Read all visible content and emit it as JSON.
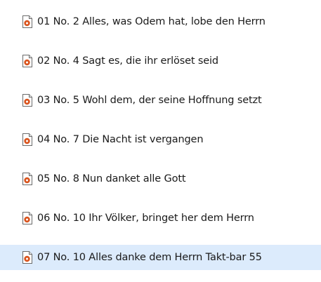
{
  "file_list": {
    "items": [
      {
        "name": "01 No. 2 Alles, was Odem hat, lobe den Herrn",
        "icon": "audio-file-icon",
        "selected": false
      },
      {
        "name": "02 No. 4 Sagt es, die ihr erlöset seid",
        "icon": "audio-file-icon",
        "selected": false
      },
      {
        "name": "03 No. 5 Wohl dem, der seine Hoffnung setzt",
        "icon": "audio-file-icon",
        "selected": false
      },
      {
        "name": "04 No. 7 Die Nacht ist vergangen",
        "icon": "audio-file-icon",
        "selected": false
      },
      {
        "name": "05 No. 8 Nun danket alle Gott",
        "icon": "audio-file-icon",
        "selected": false
      },
      {
        "name": "06 No. 10 Ihr Völker, bringet her dem Herrn",
        "icon": "audio-file-icon",
        "selected": false
      },
      {
        "name": "07 No. 10 Alles danke dem Herrn Takt-bar 55",
        "icon": "audio-file-icon",
        "selected": true
      }
    ],
    "colors": {
      "selection": "#dcebfc",
      "icon_accent": "#d9541e",
      "text": "#1a1a1a"
    }
  }
}
